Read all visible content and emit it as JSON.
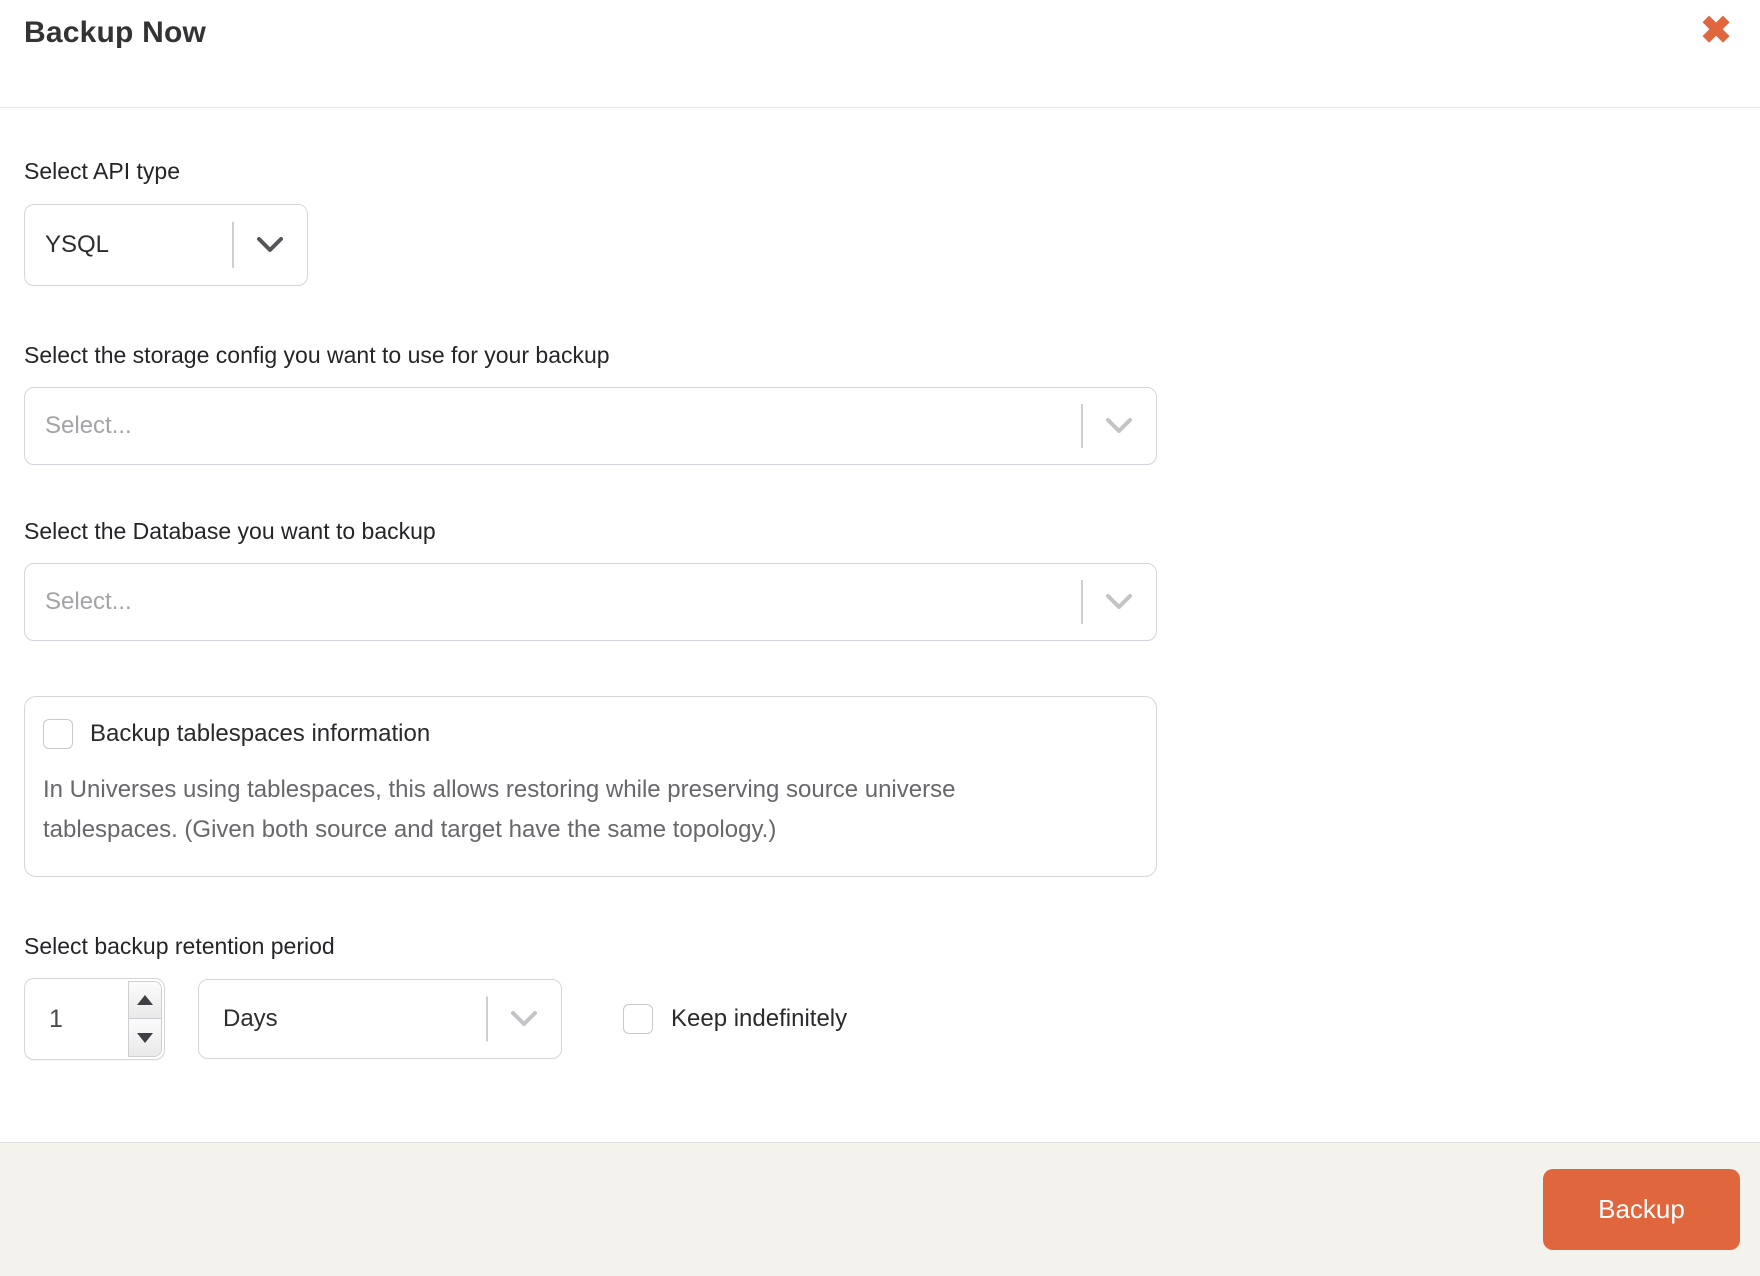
{
  "header": {
    "title": "Backup Now",
    "close_icon": "✖"
  },
  "form": {
    "api_type": {
      "label": "Select API type",
      "value": "YSQL"
    },
    "storage_config": {
      "label": "Select the storage config you want to use for your backup",
      "placeholder": "Select..."
    },
    "database": {
      "label": "Select the Database you want to backup",
      "placeholder": "Select..."
    },
    "tablespaces": {
      "checkbox_label": "Backup tablespaces information",
      "checked": false,
      "description": "In Universes using tablespaces, this allows restoring while preserving source universe tablespaces. (Given both source and target have the same topology.)"
    },
    "retention": {
      "label": "Select backup retention period",
      "value": "1",
      "unit": "Days",
      "keep_indefinitely_label": "Keep indefinitely",
      "keep_indefinitely_checked": false
    }
  },
  "footer": {
    "backup_button_label": "Backup"
  },
  "colors": {
    "accent_orange": "#e0663e",
    "border_gray": "#d6d6da",
    "placeholder_gray": "#a3a3a8",
    "footer_bg": "#f4f2ed",
    "text_dark": "#2a2a2e",
    "text_muted": "#68676d"
  }
}
